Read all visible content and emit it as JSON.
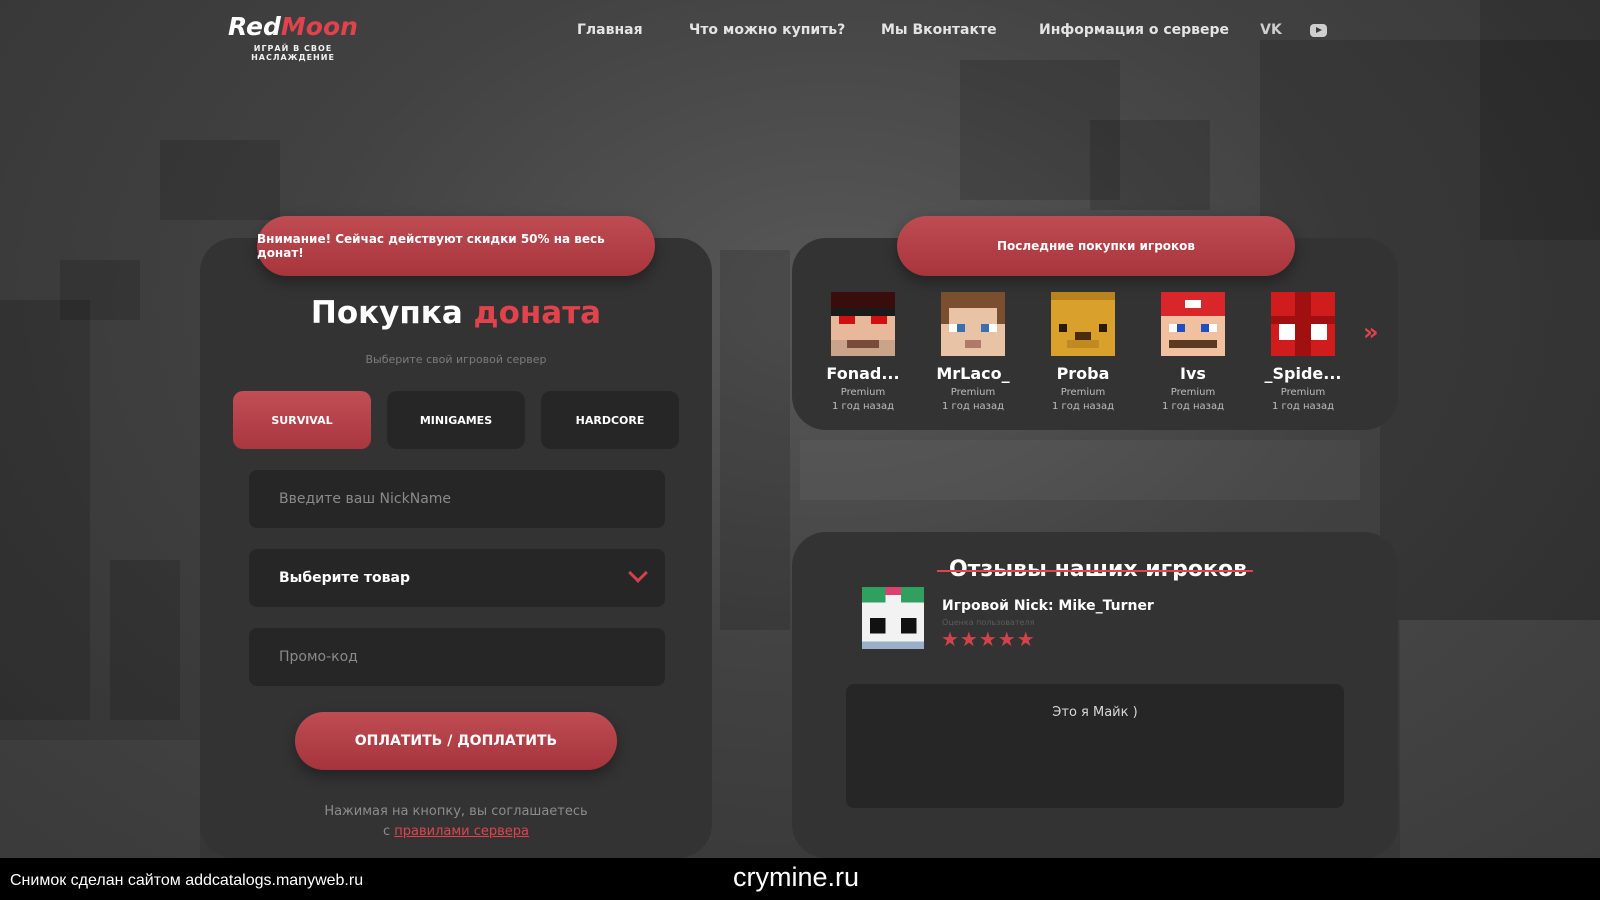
{
  "brand": {
    "name_a": "Red",
    "name_b": "Moon",
    "tagline": "ИГРАЙ В СВОЕ НАСЛАЖДЕНИЕ"
  },
  "nav": {
    "items": [
      "Главная",
      "Что можно купить?",
      "Мы Вконтакте",
      "Информация о сервере"
    ],
    "icons": [
      "vk-icon",
      "youtube-icon"
    ],
    "vk_label": "VK"
  },
  "donate": {
    "banner": "Внимание! Сейчас действуют скидки 50% на весь донат!",
    "title_a": "Покупка",
    "title_b": "доната",
    "subtitle": "Выберите свой игровой сервер",
    "servers": [
      "SURVIVAL",
      "MINIGAMES",
      "HARDCORE"
    ],
    "active_server": "SURVIVAL",
    "nick_placeholder": "Введите ваш NickName",
    "product_select": "Выберите товар",
    "promo_placeholder": "Промо-код",
    "pay_label": "ОПЛАТИТЬ / ДОПЛАТИТЬ",
    "agree_text": "Нажимая на кнопку, вы соглашаетесь",
    "agree_prefix": "с",
    "agree_link": "правилами сервера"
  },
  "purchases": {
    "title": "Последние покупки игроков",
    "items": [
      {
        "name": "Fonad...",
        "rank": "Premium",
        "time": "1 год назад"
      },
      {
        "name": "MrLaco_",
        "rank": "Premium",
        "time": "1 год назад"
      },
      {
        "name": "Proba",
        "rank": "Premium",
        "time": "1 год назад"
      },
      {
        "name": "Ivs",
        "rank": "Premium",
        "time": "1 год назад"
      },
      {
        "name": "_Spide...",
        "rank": "Premium",
        "time": "1 год назад"
      }
    ],
    "next_arrow": "»"
  },
  "reviews": {
    "title": "Отзывы наших игроков",
    "nick": "Игровой Nick: Mike_Turner",
    "rating_label": "Оценка пользователя",
    "stars": "★★★★★",
    "rating": 5,
    "text": "Это я Майк )"
  },
  "footer": {
    "left": "Снимок сделан сайтом addcatalogs.manyweb.ru",
    "center": "crymine.ru"
  },
  "colors": {
    "accent": "#e0434c",
    "button": "#b33d45",
    "panel": "#333334",
    "field": "#262627"
  }
}
